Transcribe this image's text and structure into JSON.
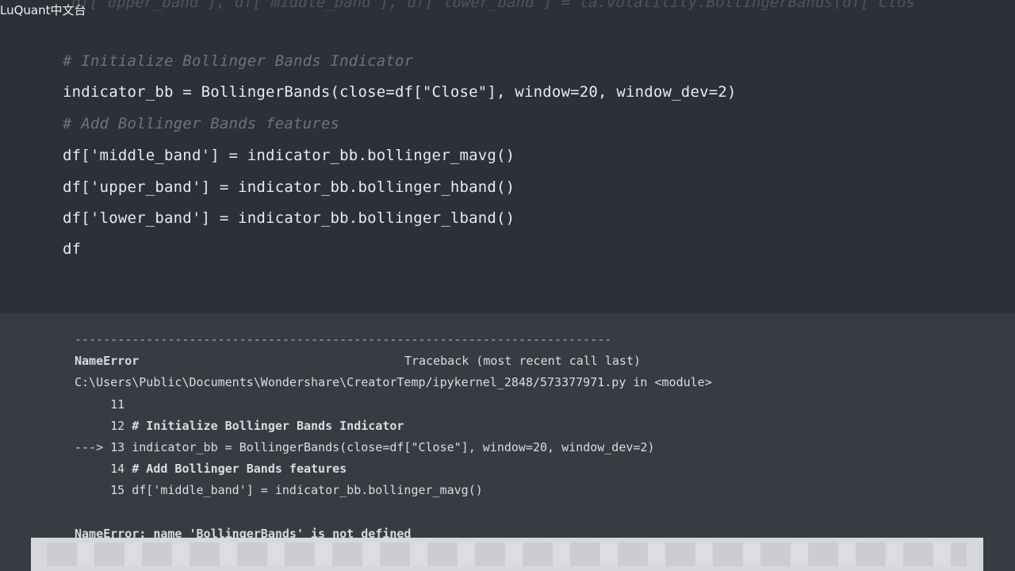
{
  "watermark": "LuQuant中文台",
  "top_faded_line": "df['upper_band'], df['middle_band'], df['lower_band'] = ta.volatility.BollingerBands(df['Clos",
  "code": {
    "comment1": "# Initialize Bollinger Bands Indicator",
    "line1": "indicator_bb = BollingerBands(close=df[\"Close\"], window=20, window_dev=2)",
    "comment2": "# Add Bollinger Bands features",
    "line2": "df['middle_band'] = indicator_bb.bollinger_mavg()",
    "line3": "df['upper_band'] = indicator_bb.bollinger_hband()",
    "line4": "df['lower_band'] = indicator_bb.bollinger_lband()",
    "line5": "df"
  },
  "output": {
    "separator": "---------------------------------------------------------------------------",
    "error_name": "NameError",
    "traceback_label": "Traceback (most recent call last)",
    "file_path": "C:\\Users\\Public\\Documents\\Wondershare\\CreatorTemp/ipykernel_2848/573377971.py in <module>",
    "tb_lines": [
      {
        "prefix": "     ",
        "num": "11",
        "text": ""
      },
      {
        "prefix": "     ",
        "num": "12",
        "text": "# Initialize Bollinger Bands Indicator"
      },
      {
        "prefix": "---> ",
        "num": "13",
        "text": "indicator_bb = BollingerBands(close=df[\"Close\"], window=20, window_dev=2)"
      },
      {
        "prefix": "     ",
        "num": "14",
        "text": "# Add Bollinger Bands features"
      },
      {
        "prefix": "     ",
        "num": "15",
        "text": "df['middle_band'] = indicator_bb.bollinger_mavg()"
      }
    ],
    "final_error": "NameError: name 'BollingerBands' is not defined"
  }
}
